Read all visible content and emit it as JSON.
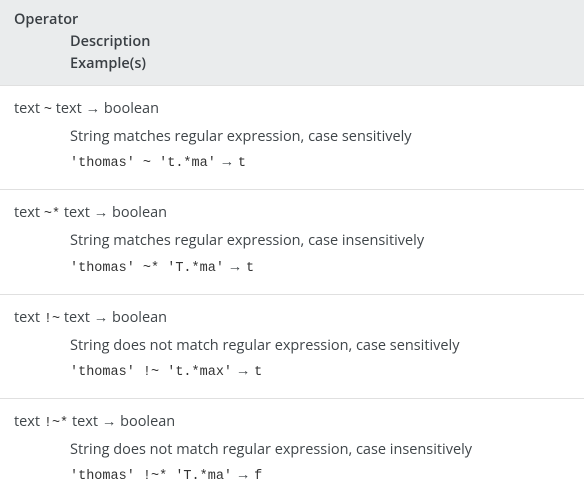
{
  "header": {
    "col_operator": "Operator",
    "col_description": "Description",
    "col_examples": "Example(s)"
  },
  "rows": [
    {
      "sig_t1": "text",
      "sig_op": "~",
      "sig_t2": "text",
      "sig_arrow": "→",
      "sig_ret": "boolean",
      "description": "String matches regular expression, case sensitively",
      "ex_expr": "'thomas' ~ 't.*ma'",
      "ex_arrow": "→",
      "ex_result": "t"
    },
    {
      "sig_t1": "text",
      "sig_op": "~*",
      "sig_t2": "text",
      "sig_arrow": "→",
      "sig_ret": "boolean",
      "description": "String matches regular expression, case insensitively",
      "ex_expr": "'thomas' ~* 'T.*ma'",
      "ex_arrow": "→",
      "ex_result": "t"
    },
    {
      "sig_t1": "text",
      "sig_op": "!~",
      "sig_t2": "text",
      "sig_arrow": "→",
      "sig_ret": "boolean",
      "description": "String does not match regular expression, case sensitively",
      "ex_expr": "'thomas' !~ 't.*max'",
      "ex_arrow": "→",
      "ex_result": "t"
    },
    {
      "sig_t1": "text",
      "sig_op": "!~*",
      "sig_t2": "text",
      "sig_arrow": "→",
      "sig_ret": "boolean",
      "description": "String does not match regular expression, case insensitively",
      "ex_expr": "'thomas' !~* 'T.*ma'",
      "ex_arrow": "→",
      "ex_result": "f"
    }
  ]
}
